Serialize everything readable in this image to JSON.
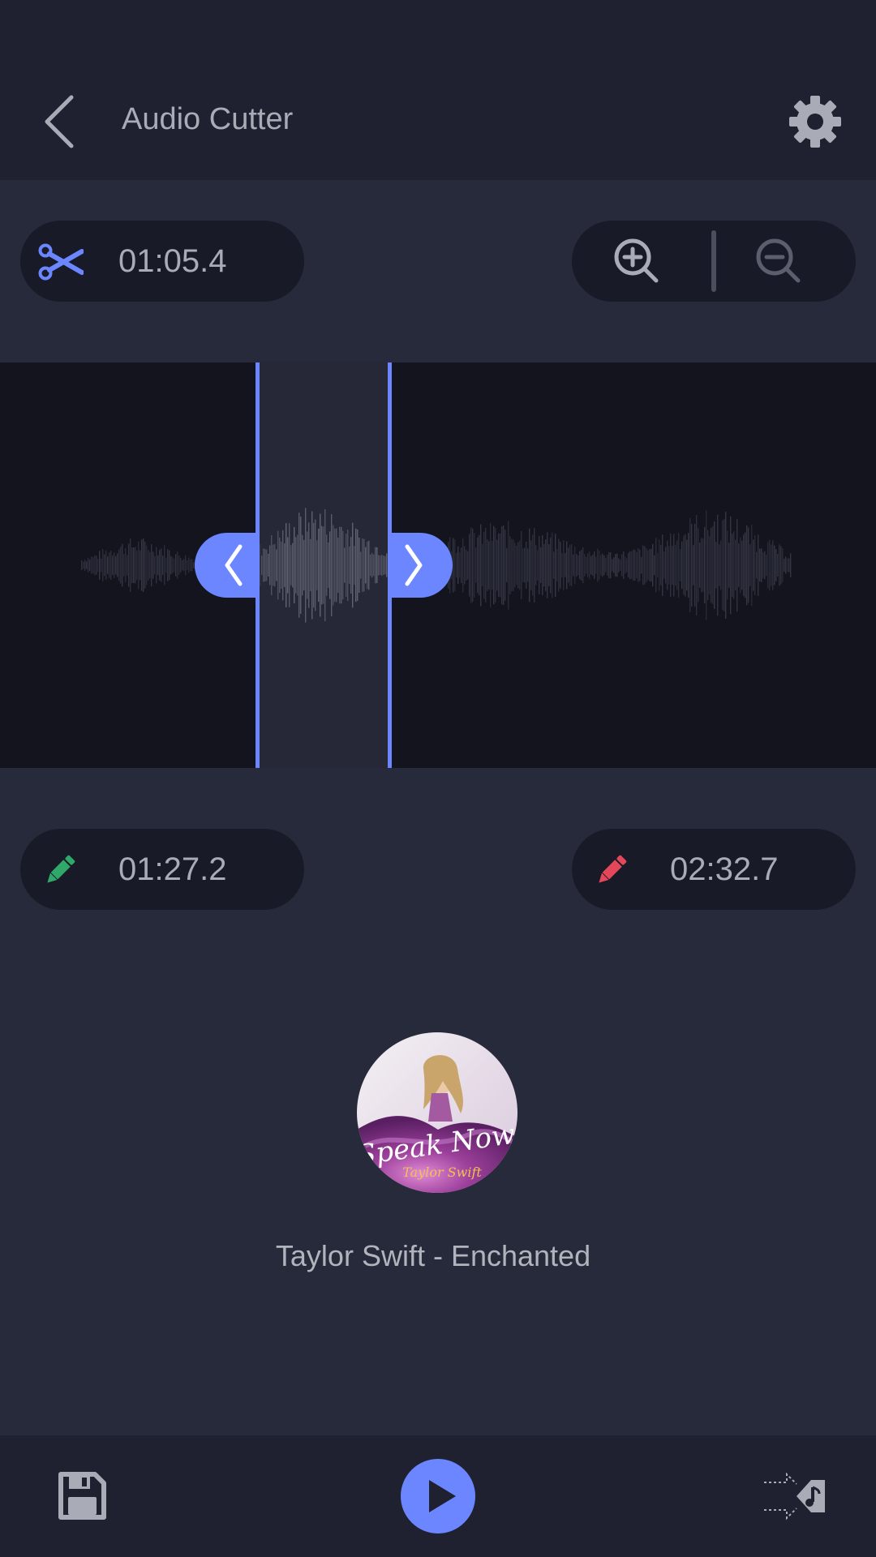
{
  "app": {
    "title": "Audio Cutter"
  },
  "icons": {
    "back": "chevron-left-icon",
    "settings": "gear-icon",
    "cut": "scissors-icon",
    "zoom_in": "zoom-in-icon",
    "zoom_out": "zoom-out-icon",
    "start_edit": "pencil-icon",
    "end_edit": "pencil-icon",
    "save": "floppy-disk-icon",
    "play": "play-icon",
    "export": "music-export-icon"
  },
  "selection": {
    "duration": "01:05.4",
    "start_time": "01:27.2",
    "end_time": "02:32.7"
  },
  "track": {
    "title": "Taylor Swift - Enchanted",
    "album_text": "Speak Now",
    "album_artist_text": "Taylor Swift"
  },
  "colors": {
    "accent": "#6c86ff",
    "start_pencil": "#2fa86a",
    "end_pencil": "#e5475a",
    "background": "#272a3a",
    "bar": "#1f2130",
    "pill": "#181a27"
  }
}
